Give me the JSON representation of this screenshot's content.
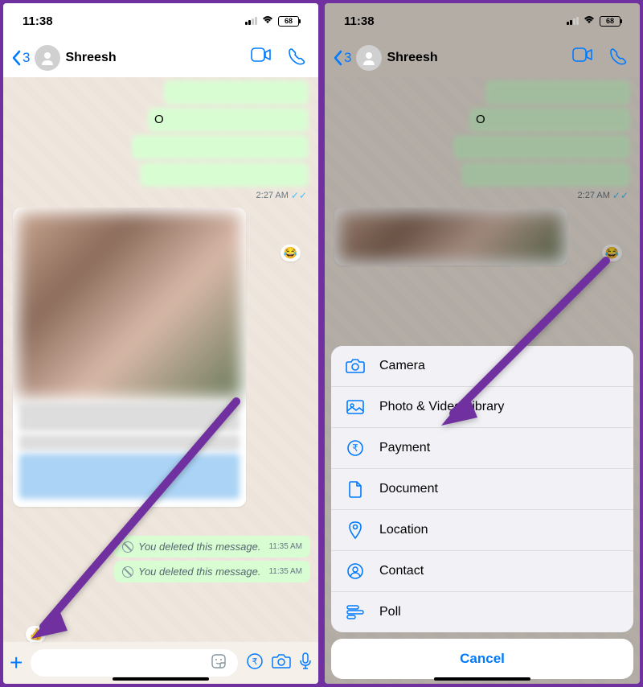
{
  "status": {
    "time": "11:38",
    "battery": "68"
  },
  "header": {
    "back_count": "3",
    "contact_name": "Shreesh"
  },
  "chat": {
    "timestamp_sent": "2:27 AM",
    "deleted_label": "You deleted this message.",
    "deleted_time": "11:35 AM",
    "reaction_laugh": "😂",
    "reaction_thumb": "👍",
    "visible_letter": "O"
  },
  "action_sheet": {
    "items": [
      {
        "label": "Camera",
        "icon": "camera"
      },
      {
        "label": "Photo & Video Library",
        "icon": "photo"
      },
      {
        "label": "Payment",
        "icon": "rupee"
      },
      {
        "label": "Document",
        "icon": "document"
      },
      {
        "label": "Location",
        "icon": "location"
      },
      {
        "label": "Contact",
        "icon": "contact"
      },
      {
        "label": "Poll",
        "icon": "poll"
      }
    ],
    "cancel": "Cancel"
  },
  "colors": {
    "accent": "#007aff",
    "arrow": "#7030a0"
  }
}
